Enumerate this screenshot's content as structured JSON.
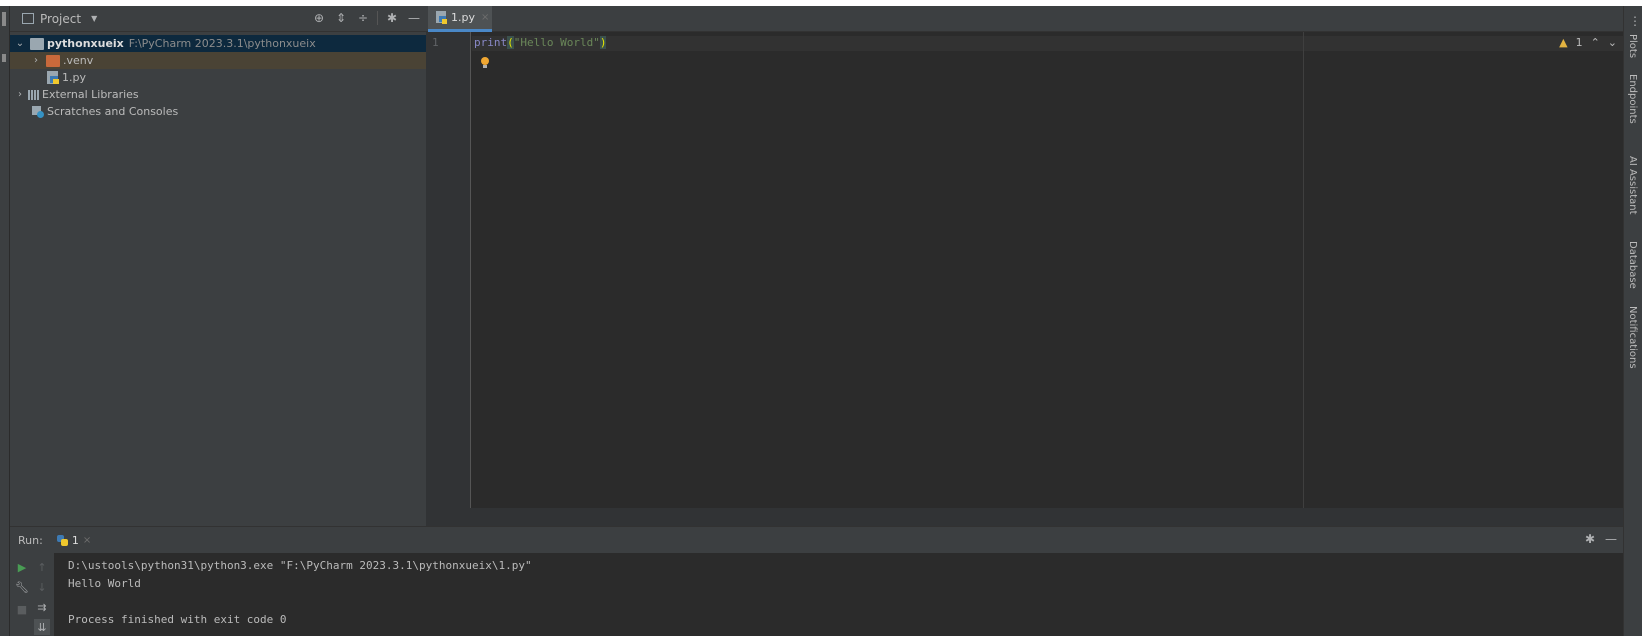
{
  "project_panel": {
    "title": "Project",
    "tree": {
      "root_name": "pythonxueix",
      "root_path": "F:\\PyCharm 2023.3.1\\pythonxueix",
      "venv": ".venv",
      "file": "1.py",
      "external_libraries": "External Libraries",
      "scratches": "Scratches and Consoles"
    }
  },
  "editor": {
    "tab_label": "1.py",
    "line_number": "1",
    "code": {
      "func": "print",
      "open_paren": "(",
      "string": "\"Hello World\"",
      "close_paren": ")"
    },
    "warning_count": "1"
  },
  "right_stripe": {
    "labels": [
      "Plots",
      "Endpoints",
      "AI Assistant",
      "Database",
      "Notifications"
    ]
  },
  "run_panel": {
    "title": "Run:",
    "tab_label": "1",
    "console": {
      "command": "D:\\ustools\\python31\\python3.exe \"F:\\PyCharm 2023.3.1\\pythonxueix\\1.py\"",
      "output": "Hello World",
      "exit": "Process finished with exit code 0"
    }
  },
  "icons": {
    "project": "project-icon",
    "locate": "locate-icon",
    "expand_all": "expand-all-icon",
    "collapse_all": "collapse-all-icon",
    "settings": "gear-icon",
    "hide": "minimize-icon",
    "python_file": "python-file-icon",
    "bulb": "intention-bulb-icon",
    "run": "run-icon",
    "stop": "stop-icon"
  },
  "colors": {
    "background": "#2b2b2b",
    "panel": "#3c3f41",
    "selection": "#0d293e",
    "string": "#6a8759",
    "keyword": "#8888c6",
    "run_green": "#499c54"
  }
}
